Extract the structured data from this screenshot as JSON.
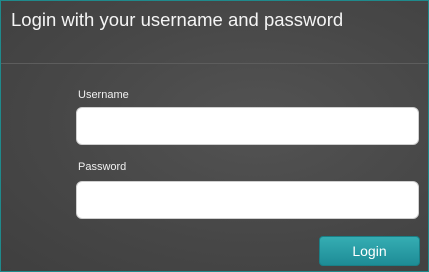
{
  "login_panel": {
    "title": "Login with your username and password",
    "username": {
      "label": "Username",
      "value": "",
      "placeholder": ""
    },
    "password": {
      "label": "Password",
      "value": "",
      "placeholder": ""
    },
    "submit_label": "Login"
  },
  "colors": {
    "panel_background": "#474747",
    "panel_border": "#1f8a8c",
    "button_accent": "#1e8c96",
    "text": "#f4f4f4"
  }
}
